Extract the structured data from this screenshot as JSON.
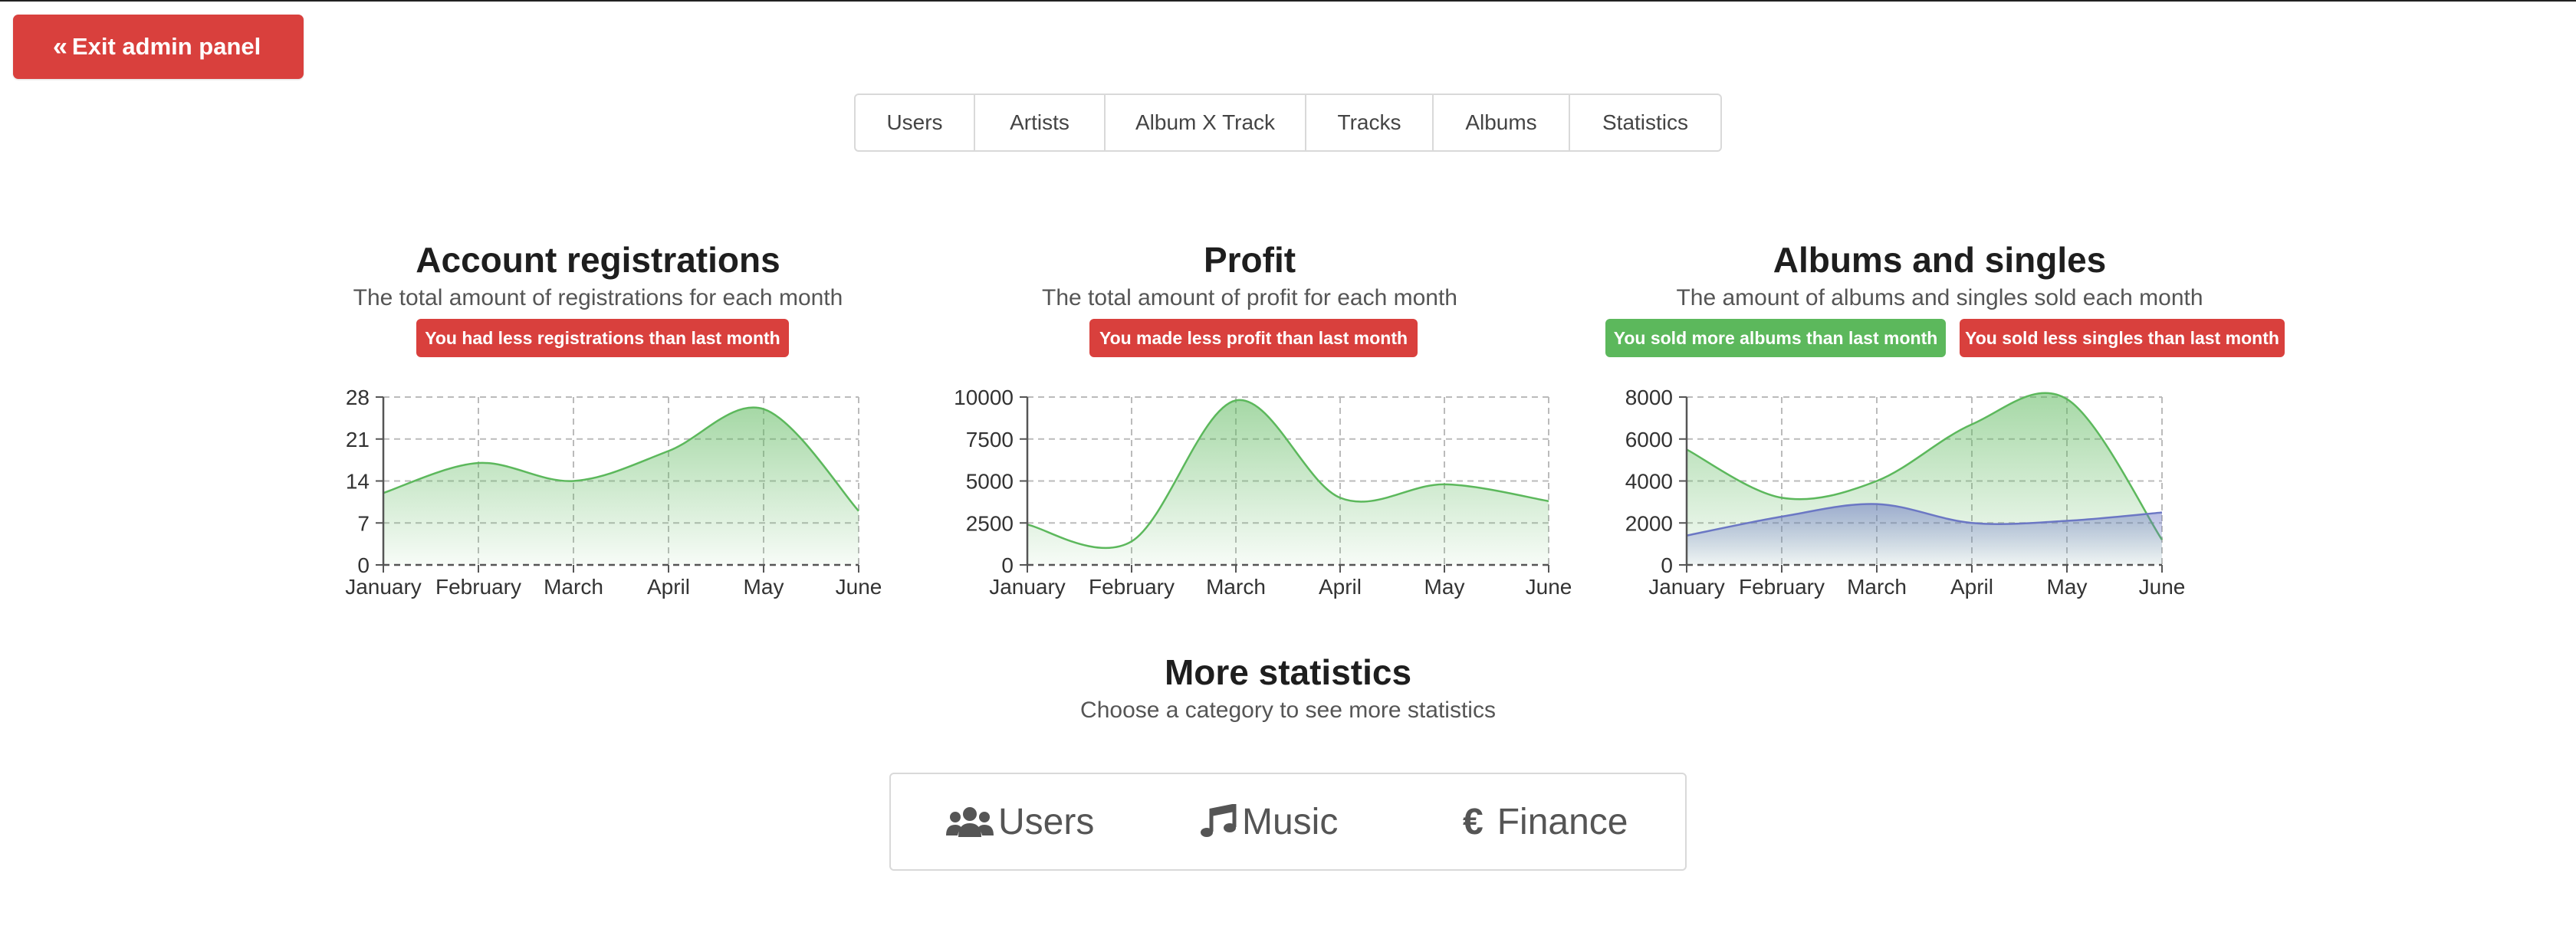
{
  "exit_button": {
    "label": "Exit admin panel",
    "icon": "chevrons-left-icon"
  },
  "tabs": [
    "Users",
    "Artists",
    "Album X Track",
    "Tracks",
    "Albums",
    "Statistics"
  ],
  "charts": [
    {
      "title": "Account registrations",
      "subtitle": "The total amount of registrations for each month",
      "badges": [
        {
          "text": "You had less registrations than last month",
          "color": "#d9403d"
        }
      ]
    },
    {
      "title": "Profit",
      "subtitle": "The total amount of profit for each month",
      "badges": [
        {
          "text": "You made less profit than last month",
          "color": "#d9403d"
        }
      ]
    },
    {
      "title": "Albums and singles",
      "subtitle": "The amount of albums and singles sold each month",
      "badges": [
        {
          "text": "You sold more albums than last month",
          "color": "#5cb85c"
        },
        {
          "text": "You sold less singles than last month",
          "color": "#d9403d"
        }
      ]
    }
  ],
  "chart_data": [
    {
      "type": "area",
      "categories": [
        "January",
        "February",
        "March",
        "April",
        "May",
        "June"
      ],
      "ylim": [
        0,
        28
      ],
      "yticks": [
        "0",
        "7",
        "14",
        "21",
        "28"
      ],
      "grid": true,
      "series": [
        {
          "values": [
            12,
            17,
            14,
            19,
            26,
            9
          ],
          "color": "#5cb85c"
        }
      ]
    },
    {
      "type": "area",
      "categories": [
        "January",
        "February",
        "March",
        "April",
        "May",
        "June"
      ],
      "ylim": [
        0,
        10000
      ],
      "yticks": [
        "0",
        "2500",
        "5000",
        "7500",
        "10000"
      ],
      "grid": true,
      "series": [
        {
          "values": [
            2400,
            1400,
            9800,
            4000,
            4800,
            3800
          ],
          "color": "#5cb85c"
        }
      ]
    },
    {
      "type": "area",
      "categories": [
        "January",
        "February",
        "March",
        "April",
        "May",
        "June"
      ],
      "ylim": [
        0,
        8000
      ],
      "yticks": [
        "0",
        "2000",
        "4000",
        "6000",
        "8000"
      ],
      "grid": true,
      "series": [
        {
          "values": [
            5500,
            3200,
            4000,
            6700,
            7900,
            1200
          ],
          "color": "#5cb85c"
        },
        {
          "values": [
            1400,
            2300,
            2900,
            2000,
            2100,
            2500
          ],
          "color": "#6b77c4"
        }
      ]
    }
  ],
  "more_stats": {
    "title": "More statistics",
    "subtitle": "Choose a category to see more statistics",
    "categories": [
      {
        "label": "Users",
        "icon": "users-icon"
      },
      {
        "label": "Music",
        "icon": "music-note-icon"
      },
      {
        "label": "Finance",
        "icon": "euro-icon"
      }
    ]
  }
}
